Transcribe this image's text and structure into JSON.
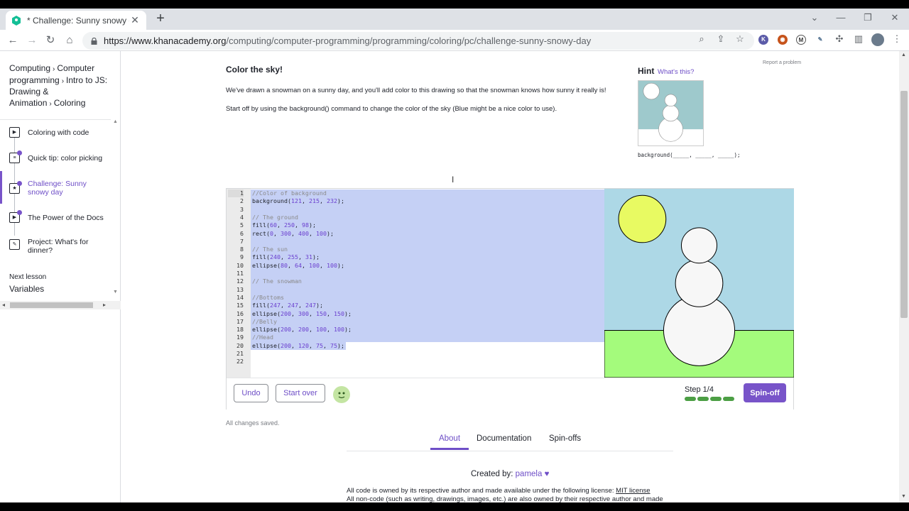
{
  "browser": {
    "tab_title": "* Challenge: Sunny snowy day | C",
    "url_host": "https://www.khanacademy.org",
    "url_path": "/computing/computer-programming/programming/coloring/pc/challenge-sunny-snowy-day",
    "new_tab_glyph": "+",
    "close_glyph": "✕",
    "icons": [
      "khan-favicon-icon",
      "lock-icon",
      "back-icon",
      "forward-icon",
      "reload-icon",
      "home-icon",
      "zoom-icon",
      "share-icon",
      "bookmark-star-icon",
      "extensions-icon",
      "profile-icon",
      "menu-icon"
    ],
    "extensions": [
      "K",
      "◉",
      "M",
      "✎"
    ]
  },
  "sidebar": {
    "breadcrumbs": [
      "Computing",
      "Computer programming",
      "Intro to JS: Drawing & Animation",
      "Coloring"
    ],
    "lessons": [
      {
        "label": "Coloring with code",
        "icon": "video-icon",
        "done": false
      },
      {
        "label": "Quick tip: color picking",
        "icon": "article-icon",
        "done": true
      },
      {
        "label": "Challenge: Sunny snowy day",
        "icon": "challenge-star-icon",
        "done": true,
        "active": true
      },
      {
        "label": "The Power of the Docs",
        "icon": "video-icon",
        "done": true
      },
      {
        "label": "Project: What's for dinner?",
        "icon": "project-icon",
        "done": false
      }
    ],
    "next_lesson_label": "Next lesson",
    "next_lesson_name": "Variables"
  },
  "task": {
    "report": "Report a problem",
    "title": "Color the sky!",
    "p1": "We've drawn a snowman on a sunny day, and you'll add color to this drawing so that the snowman knows how sunny it really is!",
    "p2": "Start off by using the background() command to change the color of the sky (Blue might be a nice color to use).",
    "hint_label": "Hint",
    "hint_what": "What's this?",
    "hint_code": "background(_____, _____, _____);"
  },
  "editor": {
    "lines": [
      {
        "n": 1,
        "text": "//Color of background",
        "kind": "comment"
      },
      {
        "n": 2,
        "text": "background(121, 215, 232);",
        "kind": "code"
      },
      {
        "n": 3,
        "text": "",
        "kind": "code"
      },
      {
        "n": 4,
        "text": "// The ground",
        "kind": "comment"
      },
      {
        "n": 5,
        "text": "fill(60, 250, 98);",
        "kind": "code"
      },
      {
        "n": 6,
        "text": "rect(0, 300, 400, 100);",
        "kind": "code"
      },
      {
        "n": 7,
        "text": "",
        "kind": "code"
      },
      {
        "n": 8,
        "text": "// The sun",
        "kind": "comment"
      },
      {
        "n": 9,
        "text": "fill(240, 255, 31);",
        "kind": "code"
      },
      {
        "n": 10,
        "text": "ellipse(80, 64, 100, 100);",
        "kind": "code"
      },
      {
        "n": 11,
        "text": "",
        "kind": "code"
      },
      {
        "n": 12,
        "text": "// The snowman",
        "kind": "comment"
      },
      {
        "n": 13,
        "text": "",
        "kind": "code"
      },
      {
        "n": 14,
        "text": "//Bottoms",
        "kind": "comment"
      },
      {
        "n": 15,
        "text": "fill(247, 247, 247);",
        "kind": "code"
      },
      {
        "n": 16,
        "text": "ellipse(200, 300, 150, 150);",
        "kind": "code"
      },
      {
        "n": 17,
        "text": "//Belly",
        "kind": "comment"
      },
      {
        "n": 18,
        "text": "ellipse(200, 200, 100, 100);",
        "kind": "code"
      },
      {
        "n": 19,
        "text": "//Head",
        "kind": "comment"
      },
      {
        "n": 20,
        "text": "ellipse(200, 120, 75, 75);",
        "kind": "code"
      },
      {
        "n": 21,
        "text": "",
        "kind": "code"
      },
      {
        "n": 22,
        "text": "",
        "kind": "code"
      }
    ],
    "colors": {
      "sky": "#add8e6",
      "ground": "#a4fb7c",
      "sun": "#e8fa62",
      "snow": "#f7f7f7",
      "number": "#6a3fcf",
      "comment": "#8a8a8a",
      "selection": "#c5d0f5"
    }
  },
  "controls": {
    "undo": "Undo",
    "start_over": "Start over",
    "step": "Step 1/4",
    "step_progress": 0.25,
    "spinoff": "Spin-off"
  },
  "status": {
    "saved": "All changes saved."
  },
  "tabs": [
    "About",
    "Documentation",
    "Spin-offs"
  ],
  "about": {
    "created_by": "Created by:",
    "author": "pamela",
    "heart": "♥",
    "license_text": "All code is owned by its respective author and made available under the following license:",
    "license_link": "MIT license",
    "license_text2": "All non-code (such as writing, drawings, images, etc.) are also owned by their respective author and made"
  }
}
